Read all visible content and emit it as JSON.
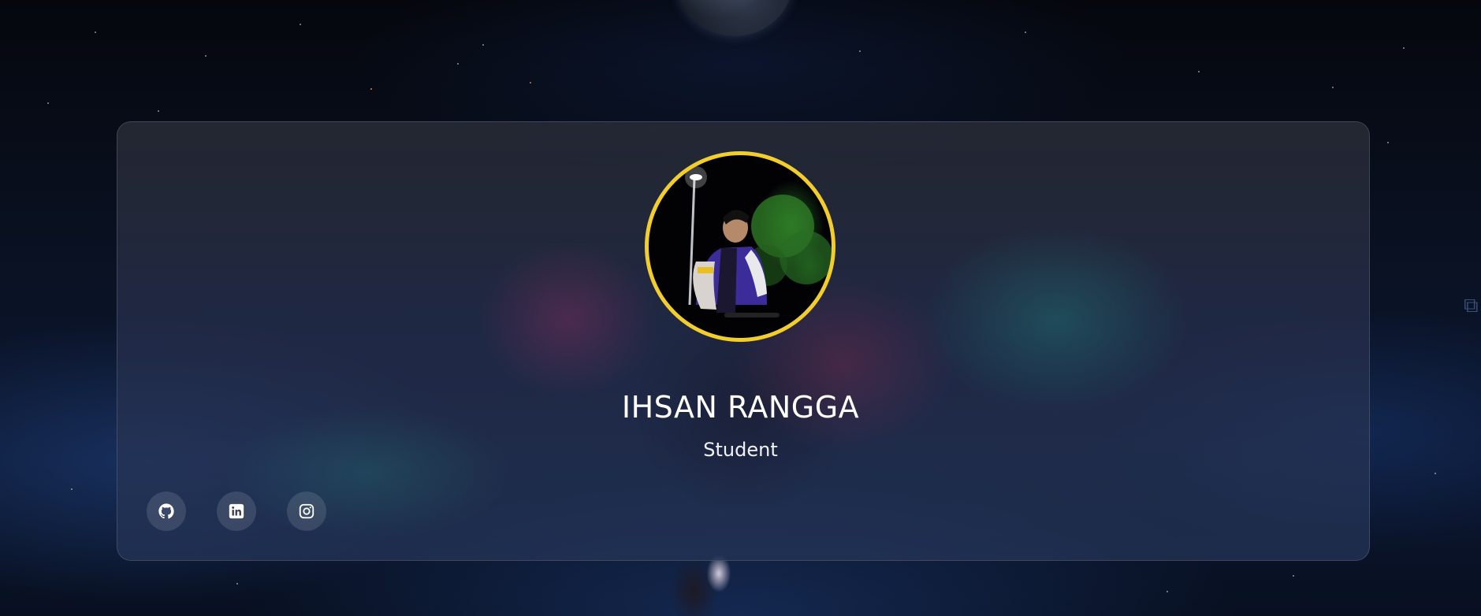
{
  "profile": {
    "name": "IHSAN RANGGA",
    "role": "Student"
  },
  "social_links": [
    {
      "icon": "github-icon"
    },
    {
      "icon": "linkedin-icon"
    },
    {
      "icon": "instagram-icon"
    }
  ],
  "colors": {
    "avatar_border": "#f2cd2e",
    "name_text": "#ffffff",
    "background": "#0a1224"
  }
}
